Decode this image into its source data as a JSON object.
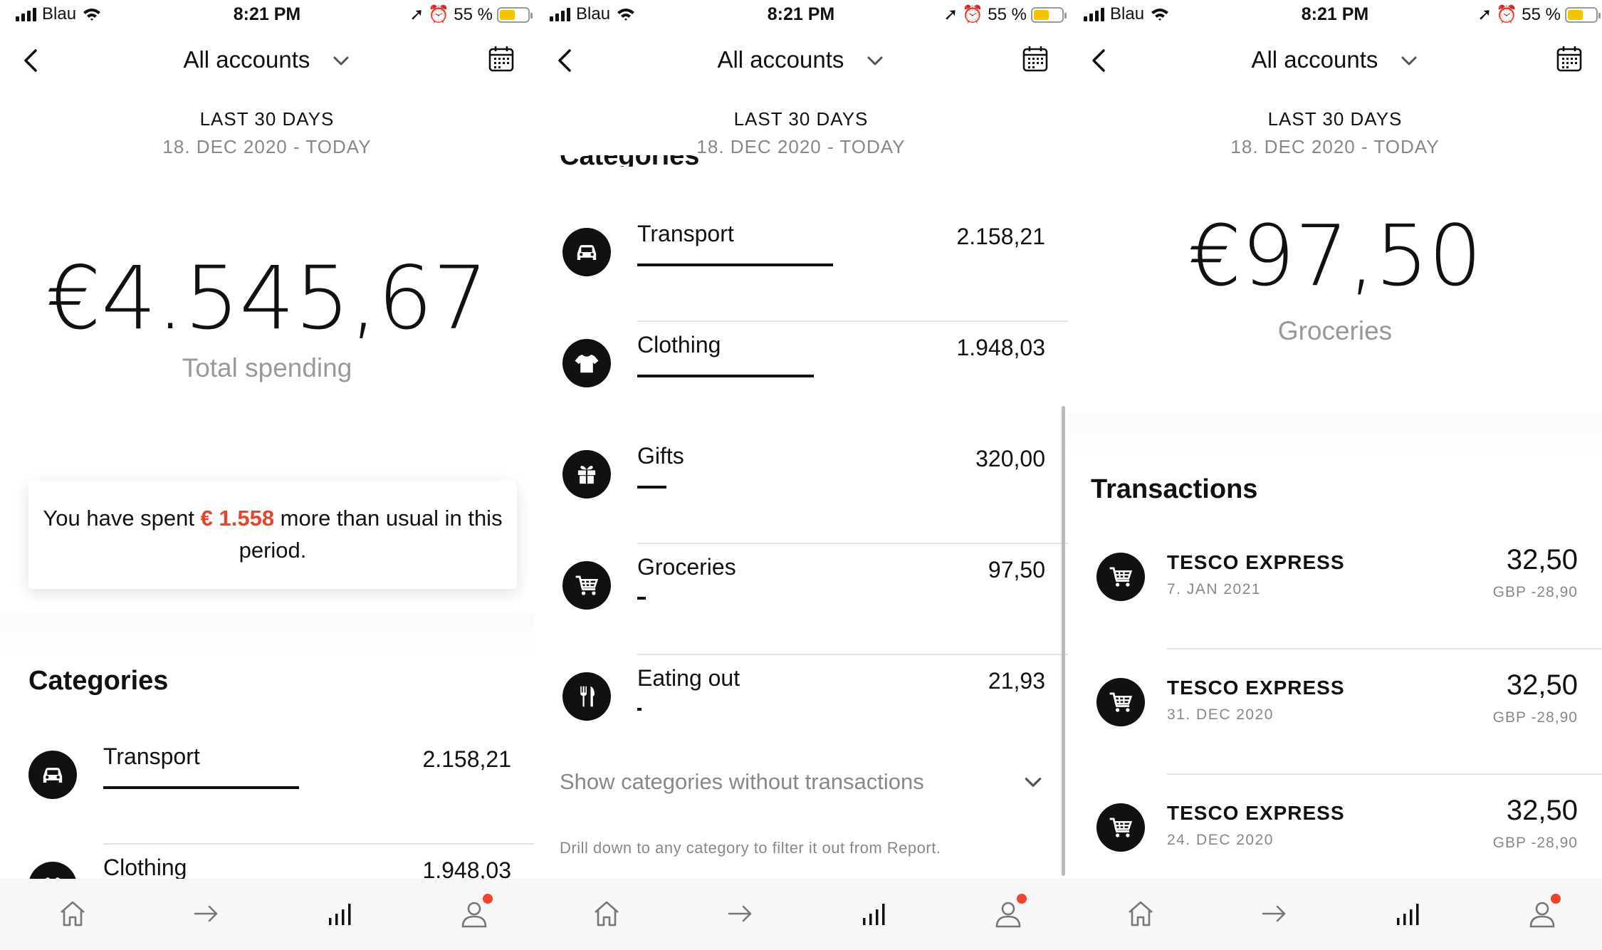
{
  "status_bar": {
    "carrier": "Blau",
    "time": "8:21 PM",
    "battery": "55 %",
    "battery_level": 0.55
  },
  "header": {
    "title": "All accounts"
  },
  "period": {
    "label": "LAST 30 DAYS",
    "range": "18. DEC 2020 - TODAY"
  },
  "screen1": {
    "currency_symbol": "€",
    "amount": "4.545,67",
    "caption": "Total spending",
    "notice": {
      "prefix": "You have spent ",
      "highlight": "€ 1.558",
      "suffix": " more than usual in this period."
    },
    "categories_title": "Categories",
    "categories": [
      {
        "name": "Transport",
        "value": "2.158,21",
        "share": 1.0,
        "icon": "car-icon"
      },
      {
        "name": "Clothing",
        "value": "1.948,03",
        "share": 0.9,
        "icon": "tshirt-icon"
      }
    ]
  },
  "screen2": {
    "categories_title": "Categories",
    "categories": [
      {
        "name": "Transport",
        "value": "2.158,21",
        "share": 1.0,
        "icon": "car-icon"
      },
      {
        "name": "Clothing",
        "value": "1.948,03",
        "share": 0.9,
        "icon": "tshirt-icon"
      },
      {
        "name": "Gifts",
        "value": "320,00",
        "share": 0.148,
        "icon": "gift-icon"
      },
      {
        "name": "Groceries",
        "value": "97,50",
        "share": 0.045,
        "icon": "cart-icon"
      },
      {
        "name": "Eating out",
        "value": "21,93",
        "share": 0.01,
        "icon": "fork-knife-icon"
      }
    ],
    "show_more": "Show categories without transactions",
    "hint": "Drill down to any category to filter it out from Report."
  },
  "screen3": {
    "currency_symbol": "€",
    "amount": "97,50",
    "caption": "Groceries",
    "transactions_title": "Transactions",
    "transactions": [
      {
        "merchant": "TESCO EXPRESS",
        "date": "7. JAN 2021",
        "amount": "32,50",
        "fx": "GBP -28,90",
        "icon": "cart-icon"
      },
      {
        "merchant": "TESCO EXPRESS",
        "date": "31. DEC 2020",
        "amount": "32,50",
        "fx": "GBP -28,90",
        "icon": "cart-icon"
      },
      {
        "merchant": "TESCO EXPRESS",
        "date": "24. DEC 2020",
        "amount": "32,50",
        "fx": "GBP -28,90",
        "icon": "cart-icon"
      }
    ]
  },
  "tabbar": {
    "items": [
      "home-icon",
      "transfer-arrow-icon",
      "report-bars-icon",
      "profile-icon"
    ],
    "badge_color": "#f0442c",
    "accent": "#e8442a"
  }
}
